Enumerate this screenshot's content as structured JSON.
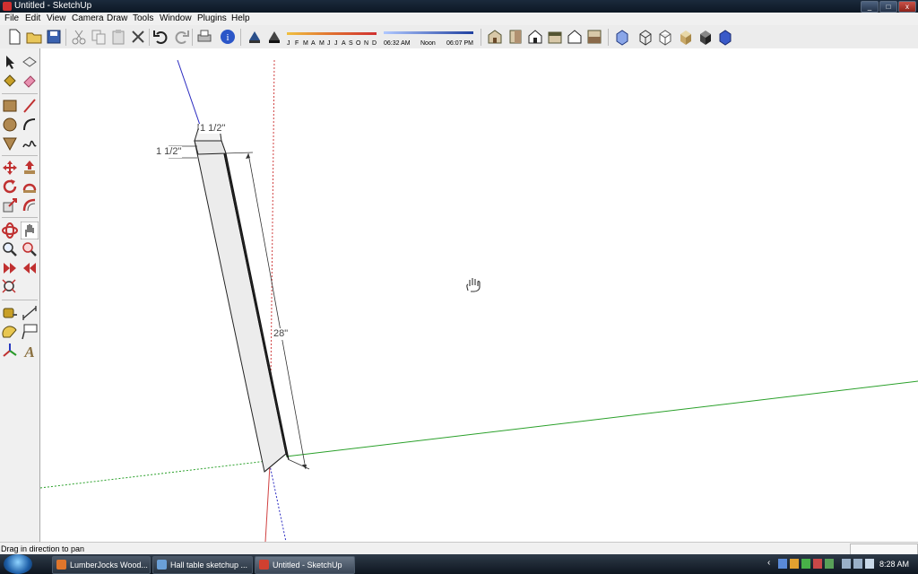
{
  "window": {
    "title": "Untitled - SketchUp",
    "min": "_",
    "max": "□",
    "close": "x"
  },
  "menu": [
    "File",
    "Edit",
    "View",
    "Camera",
    "Draw",
    "Tools",
    "Window",
    "Plugins",
    "Help"
  ],
  "shadows": {
    "months": [
      "J",
      "F",
      "M",
      "A",
      "M",
      "J",
      "J",
      "A",
      "S",
      "O",
      "N",
      "D"
    ],
    "time_start": "06:32 AM",
    "time_noon": "Noon",
    "time_end": "06:07 PM"
  },
  "model": {
    "dims": {
      "length": "28\"",
      "width": "1 1/2\"",
      "depth": "1 1/2\""
    },
    "cursor": "pan-hand-icon"
  },
  "status": {
    "text": "Drag in direction to pan"
  },
  "taskbar": {
    "tasks": [
      {
        "label": "LumberJocks Wood...",
        "icon_color": "#e0762c"
      },
      {
        "label": "Hall table sketchup ...",
        "icon_color": "#6aa0d8"
      },
      {
        "label": "Untitled - SketchUp",
        "icon_color": "#d04030"
      }
    ],
    "clock": "8:28 AM"
  },
  "colors": {
    "axis_red": "#d04040",
    "axis_green": "#2aa02a",
    "axis_blue": "#3030c0",
    "titlebar": "#0c1724"
  }
}
